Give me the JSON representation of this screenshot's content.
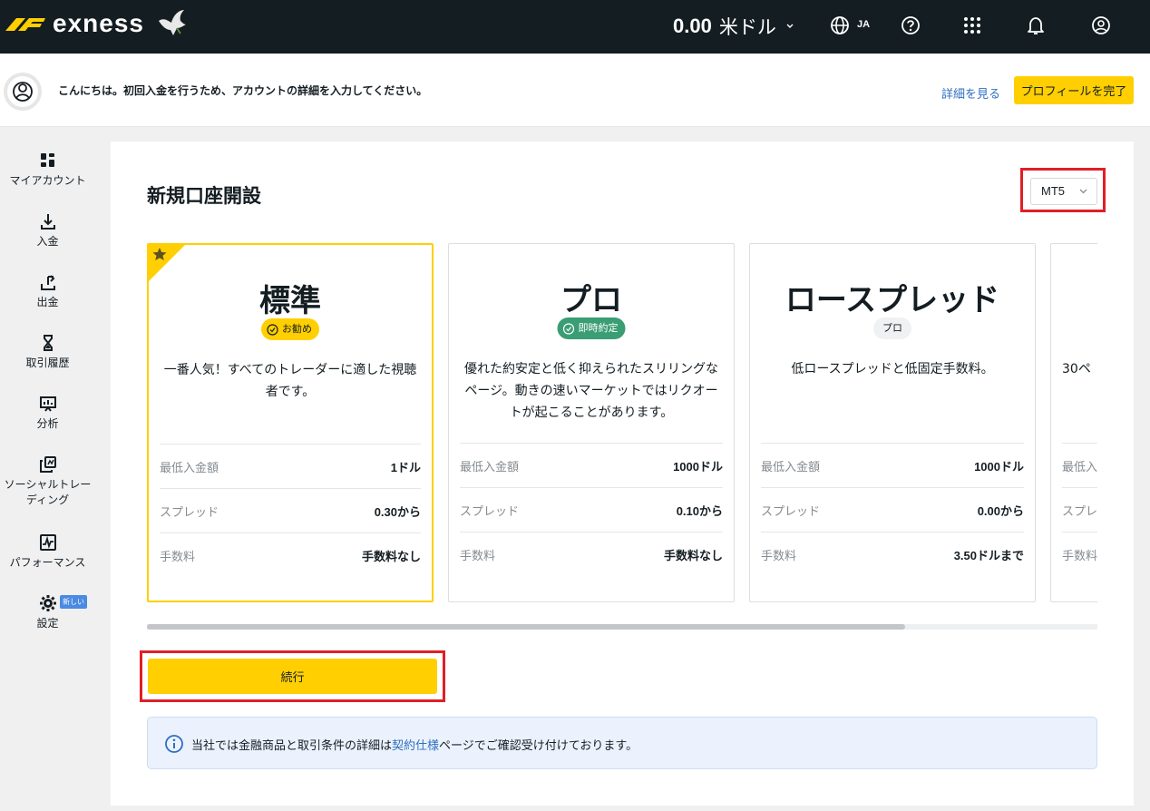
{
  "header": {
    "logo_text": "exness",
    "balance_amount": "0.00",
    "balance_currency": "米ドル",
    "language": "JA",
    "icons": [
      "globe-icon",
      "help-icon",
      "apps-grid-icon",
      "bell-icon",
      "user-profile-icon"
    ]
  },
  "notice": {
    "text": "こんにちは。初回入金を行うため、アカウントの詳細を入力してください。",
    "details_link": "詳細を見る",
    "complete_button": "プロフィールを完了"
  },
  "sidebar": {
    "items": [
      {
        "label": "マイアカウント",
        "icon": "dashboard-icon"
      },
      {
        "label": "入金",
        "icon": "download-icon"
      },
      {
        "label": "出金",
        "icon": "upload-icon"
      },
      {
        "label": "取引履歴",
        "icon": "hourglass-icon"
      },
      {
        "label": "分析",
        "icon": "presentation-chart-icon"
      },
      {
        "label": "ソーシャルトレーディング",
        "icon": "copy-icon"
      },
      {
        "label": "パフォーマンス",
        "icon": "activity-chart-icon"
      },
      {
        "label": "設定",
        "icon": "gear-icon",
        "badge": "新しい"
      }
    ]
  },
  "main": {
    "title": "新規口座開設",
    "platform": "MT5",
    "cards": [
      {
        "name": "標準",
        "badge": "お勧め",
        "badge_style": "yellow",
        "description": "一番人気！すべてのトレーダーに適した視聴者です。",
        "rows": [
          {
            "label": "最低入金額",
            "value": "1ドル"
          },
          {
            "label": "スプレッド",
            "value": "0.30から"
          },
          {
            "label": "手数料",
            "value": "手数料なし"
          }
        ]
      },
      {
        "name": "プロ",
        "badge": "即時約定",
        "badge_style": "green",
        "description": "優れた約安定と低く抑えられたスリリングなページ。動きの速いマーケットではリクオートが起こることがあります。",
        "rows": [
          {
            "label": "最低入金額",
            "value": "1000ドル"
          },
          {
            "label": "スプレッド",
            "value": "0.10から"
          },
          {
            "label": "手数料",
            "value": "手数料なし"
          }
        ]
      },
      {
        "name": "ロースプレッド",
        "badge": "プロ",
        "badge_style": "grey",
        "description": "低ロースプレッドと低固定手数料。",
        "rows": [
          {
            "label": "最低入金額",
            "value": "1000ドル"
          },
          {
            "label": "スプレッド",
            "value": "0.00から"
          },
          {
            "label": "手数料",
            "value": "3.50ドルまで"
          }
        ]
      },
      {
        "name": "",
        "badge": "",
        "badge_style": "none",
        "description": "30ペ",
        "rows": [
          {
            "label": "最低入",
            "value": ""
          },
          {
            "label": "スプレッ",
            "value": ""
          },
          {
            "label": "手数料",
            "value": ""
          }
        ]
      }
    ],
    "continue_button": "続行",
    "info": {
      "text_before": "当社では金融商品と取引条件の詳細は",
      "link": "契約仕様",
      "text_after": "ページでご確認受け付けております。"
    }
  },
  "colors": {
    "brand_yellow": "#ffcf01",
    "header_bg": "#141d22",
    "highlight_red": "#e01f26",
    "badge_green": "#3a9d74",
    "link_blue": "#2f6fbf"
  }
}
